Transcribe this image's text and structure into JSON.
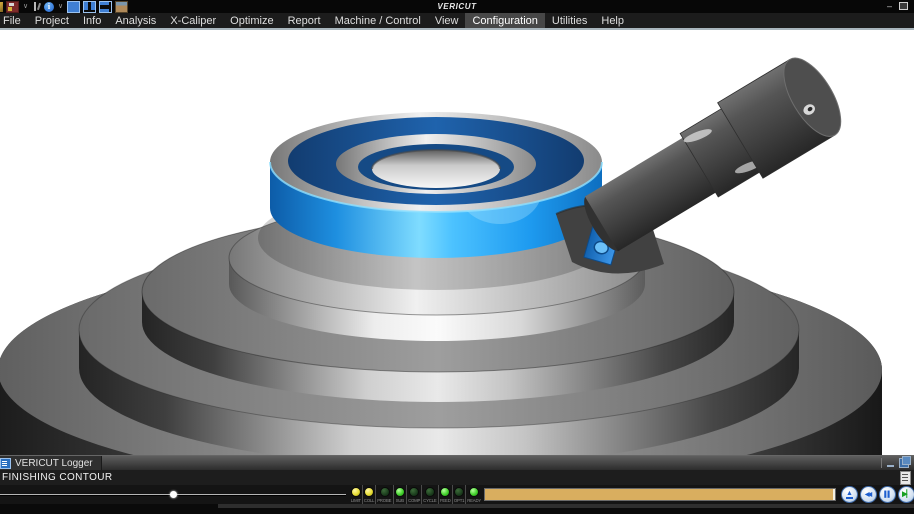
{
  "title_bar": {
    "app_title": "VERICUT",
    "toolbar_icons": [
      "open-icon",
      "save-icon",
      "dropdown-chevron-icon",
      "tools-icon",
      "info-icon",
      "dropdown-chevron-icon",
      "layout-single-icon",
      "layout-vertical-split-icon",
      "layout-horizontal-split-icon",
      "snapshot-icon"
    ],
    "window_controls": {
      "minimize_glyph": "–",
      "pin_glyph": "+",
      "help_glyph": "?"
    }
  },
  "menu_bar": {
    "items": [
      "File",
      "Project",
      "Info",
      "Analysis",
      "X-Caliper",
      "Optimize",
      "Report",
      "Machine / Control",
      "View",
      "Configuration",
      "Utilities",
      "Help"
    ],
    "active_item": "Configuration",
    "chevron_glyph": "∨",
    "info_glyph": "i"
  },
  "viewport": {
    "background_color": "#ffffff",
    "part_outer_color": "#2aa1f0",
    "part_top_color": "#1c5fa6",
    "tool_color": "#454545",
    "turntable_color": "#a8a8a8",
    "clamp_color": "#1f7ad0"
  },
  "logger": {
    "tab_label": "VERICUT Logger",
    "message": "FINISHING CONTOUR",
    "slider": {
      "position_percent": 49,
      "position_css": "49%"
    },
    "indicators": [
      {
        "label": "LIMIT",
        "state": "yellow"
      },
      {
        "label": "COLL",
        "state": "yellow"
      },
      {
        "label": "PROBE",
        "state": "off"
      },
      {
        "label": "SUB",
        "state": "on"
      },
      {
        "label": "COMP",
        "state": "off"
      },
      {
        "label": "CYCLE",
        "state": "off"
      },
      {
        "label": "FEED",
        "state": "on"
      },
      {
        "label": "OPT1",
        "state": "off"
      },
      {
        "label": "READY",
        "state": "on"
      }
    ],
    "indicator_colors": {
      "yellow": "#e8df35",
      "on": "#43d32c",
      "off": "#1b3d1d"
    },
    "progress": {
      "fill_percent": 100,
      "fill_color": "#d9ae5f"
    },
    "playback_buttons": [
      {
        "name": "eject-button",
        "kind": "eject",
        "glyph": "▲",
        "color": "#1d5ecf"
      },
      {
        "name": "rewind-button",
        "kind": "rewind",
        "glyph": "◀◀",
        "color": "#1d5ecf"
      },
      {
        "name": "pause-button",
        "kind": "pause",
        "glyph": "▌▌",
        "color": "#1d5ecf"
      },
      {
        "name": "step-button",
        "kind": "step",
        "glyph": "▶▏",
        "color": "#17a021"
      },
      {
        "name": "play-button",
        "kind": "play",
        "glyph": "▶",
        "color": "#17a021"
      }
    ]
  }
}
